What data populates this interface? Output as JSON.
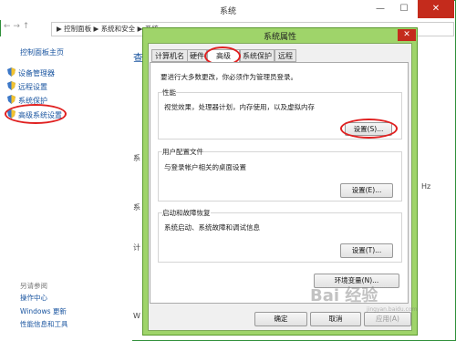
{
  "system_window": {
    "title": "系统",
    "breadcrumb": "▶ 控制面板 ▶ 系统和安全 ▶ 系统",
    "min_label": "—",
    "max_label": "☐",
    "close_label": "✕",
    "home_link": "控制面板主页",
    "sidebar": [
      {
        "label": "设备管理器"
      },
      {
        "label": "远程设置"
      },
      {
        "label": "系统保护"
      },
      {
        "label": "高级系统设置"
      }
    ],
    "see_also": "另请参阅",
    "bottom_links": [
      {
        "label": "操作中心"
      },
      {
        "label": "Windows 更新"
      },
      {
        "label": "性能信息和工具"
      }
    ],
    "main_fragments": [
      "查",
      "系",
      "系",
      "计",
      "Hz",
      "W"
    ]
  },
  "dialog": {
    "title": "系统属性",
    "close_label": "✕",
    "tabs": [
      {
        "label": "计算机名",
        "active": false
      },
      {
        "label": "硬件",
        "active": false
      },
      {
        "label": "高级",
        "active": true
      },
      {
        "label": "系统保护",
        "active": false
      },
      {
        "label": "远程",
        "active": false
      }
    ],
    "admin_note": "要进行大多数更改，你必须作为管理员登录。",
    "groups": [
      {
        "label": "性能",
        "description": "视觉效果，处理器计划，内存使用，以及虚拟内存",
        "button": "设置(S)..."
      },
      {
        "label": "用户配置文件",
        "description": "与登录帐户相关的桌面设置",
        "button": "设置(E)..."
      },
      {
        "label": "启动和故障恢复",
        "description": "系统启动、系统故障和调试信息",
        "button": "设置(T)..."
      }
    ],
    "env_button": "环境变量(N)...",
    "ok": "确定",
    "cancel": "取消",
    "apply": "应用(A)"
  },
  "watermark": {
    "text": "Bai 经验",
    "url": "jingyan.baidu.com"
  },
  "colors": {
    "highlight": "#e02020",
    "dialog_frame": "#9fd46a",
    "link": "#1a55a0"
  }
}
